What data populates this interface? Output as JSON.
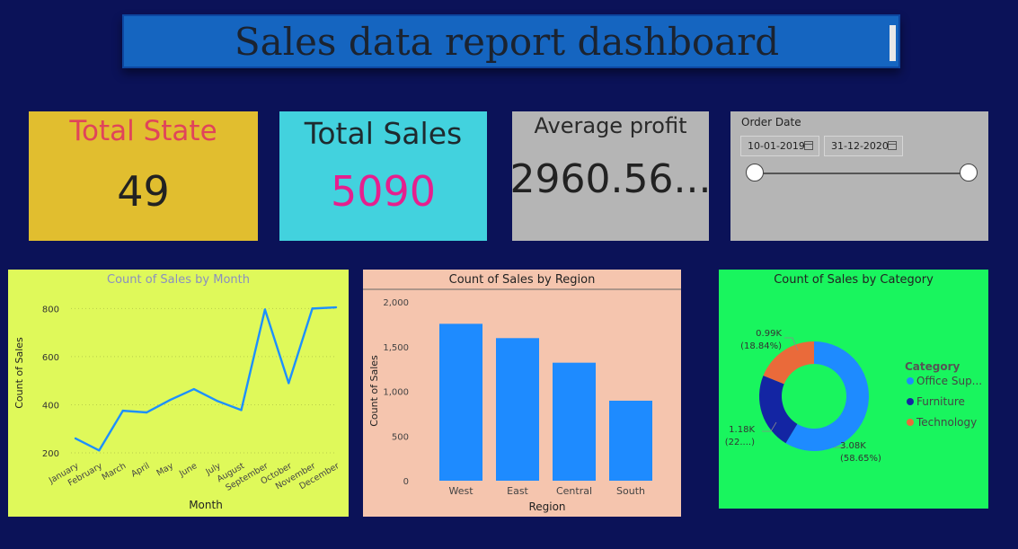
{
  "header": {
    "title": "Sales data report dashboard"
  },
  "cards": {
    "total_state": {
      "label": "Total State",
      "value": "49"
    },
    "total_sales": {
      "label": "Total Sales",
      "value": "5090"
    },
    "avg_profit": {
      "label": "Average profit",
      "value": "2960.56..."
    }
  },
  "slicer": {
    "label": "Order Date",
    "start": "10-01-2019",
    "end": "31-12-2020",
    "icon": "calendar-icon"
  },
  "colors": {
    "background": "#0b1258",
    "title_bar": "#1565c0",
    "state_card": "#e1be2f",
    "sales_card": "#42d2de",
    "profit_card": "#b5b5b5",
    "state_label": "#e0445a",
    "sales_value": "#e61f8e",
    "line": "#1e90ff",
    "bar": "#1e8bff",
    "office_supplies": "#1e8bff",
    "furniture": "#1325a3",
    "technology": "#ea6a3a"
  },
  "chart_data": [
    {
      "type": "line",
      "title": "Count of Sales by Month",
      "xlabel": "Month",
      "ylabel": "Count of Sales",
      "categories": [
        "January",
        "February",
        "March",
        "April",
        "May",
        "June",
        "July",
        "August",
        "September",
        "October",
        "November",
        "December"
      ],
      "values": [
        260,
        210,
        375,
        368,
        420,
        465,
        415,
        378,
        796,
        490,
        800,
        805
      ],
      "yticks": [
        "200",
        "400",
        "600",
        "800"
      ],
      "ylim": [
        170,
        850
      ],
      "grid": true
    },
    {
      "type": "bar",
      "title": "Count of Sales by Region",
      "xlabel": "Region",
      "ylabel": "Count of Sales",
      "categories": [
        "West",
        "East",
        "Central",
        "South"
      ],
      "values": [
        1755,
        1595,
        1320,
        895
      ],
      "yticks": [
        "0",
        "500",
        "1,000",
        "1,500",
        "2,000"
      ],
      "ylim": [
        0,
        2000
      ]
    },
    {
      "type": "pie",
      "title": "Count of Sales by Category",
      "legend_title": "Category",
      "legend_position": "right",
      "slices": [
        {
          "name": "Office Sup...",
          "value": 58.65,
          "label_value": "3.08K",
          "label_pct": "(58.65%)"
        },
        {
          "name": "Furniture",
          "value": 22.51,
          "label_value": "1.18K",
          "label_pct": "(22....)"
        },
        {
          "name": "Technology",
          "value": 18.84,
          "label_value": "0.99K",
          "label_pct": "(18.84%)"
        }
      ]
    }
  ]
}
